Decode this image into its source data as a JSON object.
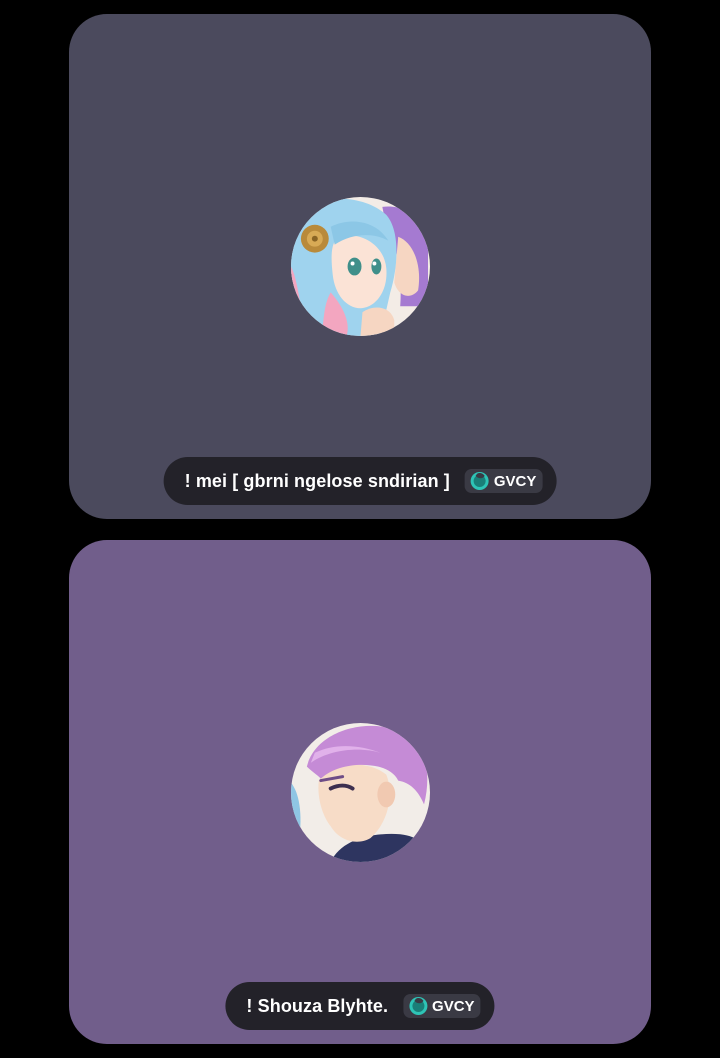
{
  "participants": [
    {
      "display_name": "! mei [ gbrni ngelose sndirian ]",
      "tag": "GVCY",
      "avatar_icon": "anime-girl-blue-hair-avatar",
      "tile_color": "#4b4a5d"
    },
    {
      "display_name": "! Shouza Blyhte.",
      "tag": "GVCY",
      "avatar_icon": "anime-boy-purple-hair-avatar",
      "tile_color": "#715e8b"
    }
  ],
  "colors": {
    "background": "#000000",
    "pill_background": "#232229",
    "tag_badge_background": "#3a3a44",
    "tag_icon_accent": "#2ec4b6"
  }
}
